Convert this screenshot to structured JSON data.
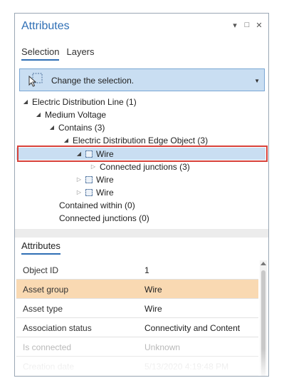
{
  "pane": {
    "title": "Attributes",
    "controls": {
      "pin_icon": "▾",
      "maximize_icon": "□",
      "close_icon": "✕"
    }
  },
  "tabs": [
    {
      "label": "Selection",
      "active": true
    },
    {
      "label": "Layers",
      "active": false
    }
  ],
  "selection_bar": {
    "text": "Change the selection.",
    "dropdown_icon": "▼"
  },
  "tree": {
    "rows": [
      {
        "label": "Electric Distribution Line (1)",
        "expanded": true
      },
      {
        "label": "Medium Voltage",
        "expanded": true
      },
      {
        "label": "Contains (3)",
        "expanded": true
      },
      {
        "label": "Electric Distribution Edge Object (3)",
        "expanded": true
      },
      {
        "label": "Wire",
        "expanded": true,
        "selected": true
      },
      {
        "label": "Connected junctions (3)",
        "expanded": false
      },
      {
        "label": "Wire",
        "expanded": false
      },
      {
        "label": "Wire",
        "expanded": false
      },
      {
        "label": "Contained within (0)"
      },
      {
        "label": "Connected junctions (0)"
      }
    ]
  },
  "attributes_section": {
    "title": "Attributes",
    "rows": [
      {
        "key": "Object ID",
        "value": "1"
      },
      {
        "key": "Asset group",
        "value": "Wire",
        "highlighted": true
      },
      {
        "key": "Asset type",
        "value": "Wire"
      },
      {
        "key": "Association status",
        "value": "Connectivity and Content"
      },
      {
        "key": "Is connected",
        "value": "Unknown"
      },
      {
        "key": "Creation date",
        "value": "5/13/2020 4:19:48 PM"
      }
    ]
  },
  "colors": {
    "accent": "#2f6fb5",
    "selection_bg": "#c9def2",
    "highlight_row": "#f9d9b2",
    "callout": "#d8423a"
  }
}
